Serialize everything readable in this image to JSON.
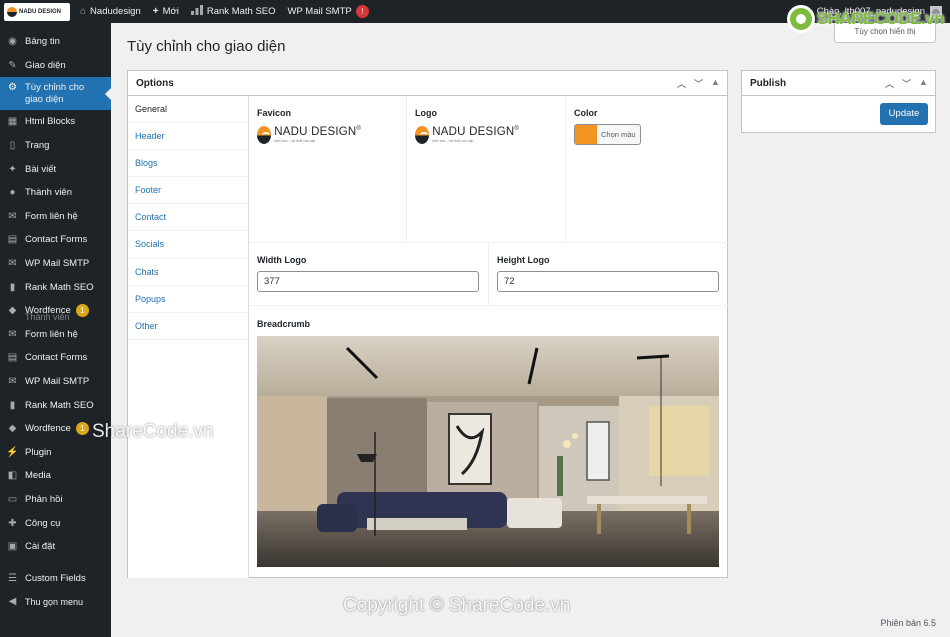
{
  "adminbar": {
    "logo_text": "NADU DESIGN",
    "site_name": "Nadudesign",
    "new_label": "Mới",
    "rankmath_label": "Rank Math SEO",
    "wpmail_label": "WP Mail SMTP",
    "wpmail_badge": "!",
    "greeting": "Chào, lth007_nadudesign"
  },
  "sidebar": {
    "items": [
      {
        "label": "Bảng tin",
        "icon": "dashboard-icon"
      },
      {
        "label": "Giao diện",
        "icon": "brush-icon"
      },
      {
        "label": "Tùy chỉnh cho giao diện",
        "icon": "gear-icon",
        "current": true
      },
      {
        "label": "Html Blocks",
        "icon": "table-icon"
      },
      {
        "label": "Trang",
        "icon": "page-icon"
      },
      {
        "label": "Bài viết",
        "icon": "pin-icon"
      },
      {
        "label": "Thành viên",
        "icon": "user-icon"
      },
      {
        "label": "Form liên hệ",
        "icon": "mail-icon"
      },
      {
        "label": "Contact Forms",
        "icon": "form-icon"
      },
      {
        "label": "WP Mail SMTP",
        "icon": "envelope-icon"
      },
      {
        "label": "Rank Math SEO",
        "icon": "chart-icon"
      },
      {
        "label": "Wordfence",
        "icon": "shield-icon",
        "badge": "1"
      },
      {
        "label": "Form liên hệ",
        "icon": "mail-icon"
      },
      {
        "label": "Contact Forms",
        "icon": "form-icon"
      },
      {
        "label": "WP Mail SMTP",
        "icon": "envelope-icon"
      },
      {
        "label": "Rank Math SEO",
        "icon": "chart-icon"
      },
      {
        "label": "Wordfence",
        "icon": "shield-icon",
        "badge": "1"
      },
      {
        "label": "Plugin",
        "icon": "plug-icon"
      },
      {
        "label": "Media",
        "icon": "media-icon"
      },
      {
        "label": "Phản hồi",
        "icon": "comment-icon"
      },
      {
        "label": "Công cụ",
        "icon": "wrench-icon"
      },
      {
        "label": "Cài đặt",
        "icon": "settings-icon"
      },
      {
        "label": "Custom Fields",
        "icon": "fields-icon"
      },
      {
        "label": "Thu gọn menu",
        "icon": "collapse-icon"
      }
    ],
    "overlap_text": "Thành viên"
  },
  "page": {
    "title": "Tùy chỉnh cho giao diện",
    "screen_options": "Tùy chọn hiển thị"
  },
  "options_box": {
    "title": "Options",
    "tabs": [
      "General",
      "Header",
      "Blogs",
      "Footer",
      "Contact",
      "Socials",
      "Chats",
      "Popups",
      "Other"
    ],
    "active_tab": "General",
    "favicon_label": "Favicon",
    "logo_label": "Logo",
    "color_label": "Color",
    "color_value": "#f39321",
    "color_button": "Chọn màu",
    "logo_brand": "NADU DESIGN",
    "logo_reg": "®",
    "logo_tagline": "kiến trúc - nội thất cao cấp",
    "width_label": "Width Logo",
    "width_value": "377",
    "height_label": "Height Logo",
    "height_value": "72",
    "breadcrumb_label": "Breadcrumb"
  },
  "publish_box": {
    "title": "Publish",
    "update_label": "Update"
  },
  "footer": {
    "version": "Phiên bản 6.5"
  },
  "watermarks": {
    "sharecode_logo": "SHARECODE.vn",
    "center": "ShareCode.vn",
    "copyright": "Copyright © ShareCode.vn"
  },
  "colors": {
    "accent": "#2271b1",
    "adminbar": "#1d2327",
    "brand_orange": "#f39321"
  }
}
